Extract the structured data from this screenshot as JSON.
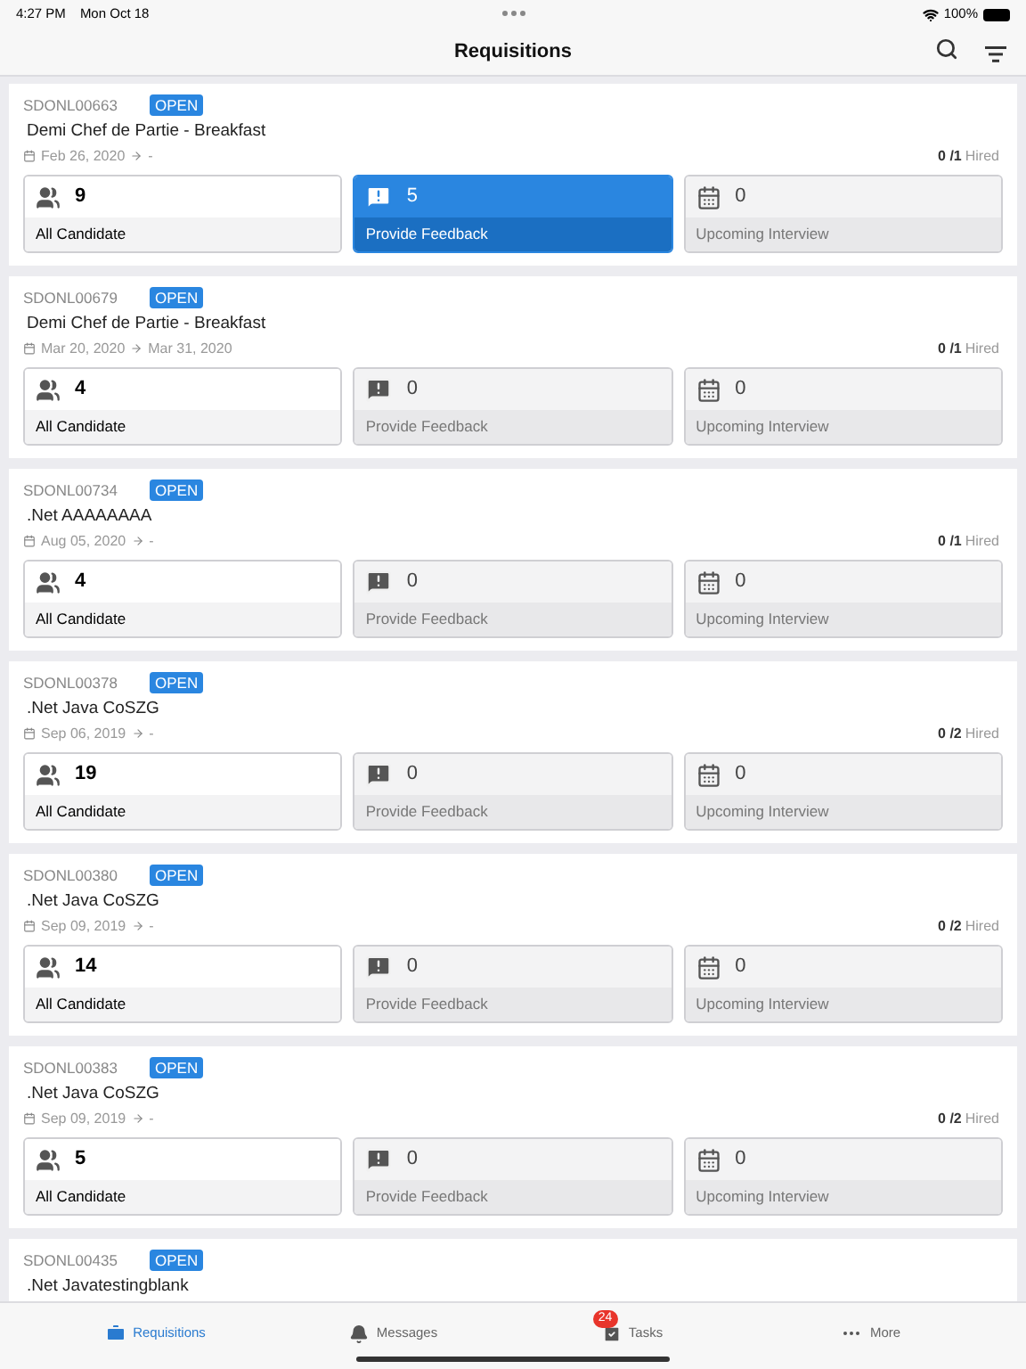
{
  "status_bar": {
    "time": "4:27 PM",
    "date": "Mon Oct 18",
    "battery": "100%"
  },
  "title": "Requisitions",
  "requisitions": [
    {
      "id": "SDONL00663",
      "status": "OPEN",
      "title": "Demi Chef de Partie - Breakfast",
      "start": "Feb 26, 2020",
      "end": "-",
      "hired": "0",
      "total": "/1",
      "hired_label": "Hired",
      "tiles": [
        {
          "kind": "candidates",
          "count": "9",
          "label": "All Candidate",
          "selected": false
        },
        {
          "kind": "feedback",
          "count": "5",
          "label": "Provide Feedback",
          "selected": true
        },
        {
          "kind": "interviews",
          "count": "0",
          "label": "Upcoming Interview",
          "selected": false
        }
      ]
    },
    {
      "id": "SDONL00679",
      "status": "OPEN",
      "title": "Demi Chef de Partie - Breakfast",
      "start": "Mar 20, 2020",
      "end": "Mar 31, 2020",
      "hired": "0",
      "total": "/1",
      "hired_label": "Hired",
      "tiles": [
        {
          "kind": "candidates",
          "count": "4",
          "label": "All Candidate",
          "selected": false
        },
        {
          "kind": "feedback",
          "count": "0",
          "label": "Provide Feedback",
          "selected": false
        },
        {
          "kind": "interviews",
          "count": "0",
          "label": "Upcoming Interview",
          "selected": false
        }
      ]
    },
    {
      "id": "SDONL00734",
      "status": "OPEN",
      "title": ".Net AAAAAAAA",
      "start": "Aug 05, 2020",
      "end": "-",
      "hired": "0",
      "total": "/1",
      "hired_label": "Hired",
      "tiles": [
        {
          "kind": "candidates",
          "count": "4",
          "label": "All Candidate",
          "selected": false
        },
        {
          "kind": "feedback",
          "count": "0",
          "label": "Provide Feedback",
          "selected": false
        },
        {
          "kind": "interviews",
          "count": "0",
          "label": "Upcoming Interview",
          "selected": false
        }
      ]
    },
    {
      "id": "SDONL00378",
      "status": "OPEN",
      "title": ".Net Java CoSZG",
      "start": "Sep 06, 2019",
      "end": "-",
      "hired": "0",
      "total": "/2",
      "hired_label": "Hired",
      "tiles": [
        {
          "kind": "candidates",
          "count": "19",
          "label": "All Candidate",
          "selected": false
        },
        {
          "kind": "feedback",
          "count": "0",
          "label": "Provide Feedback",
          "selected": false
        },
        {
          "kind": "interviews",
          "count": "0",
          "label": "Upcoming Interview",
          "selected": false
        }
      ]
    },
    {
      "id": "SDONL00380",
      "status": "OPEN",
      "title": ".Net Java CoSZG",
      "start": "Sep 09, 2019",
      "end": "-",
      "hired": "0",
      "total": "/2",
      "hired_label": "Hired",
      "tiles": [
        {
          "kind": "candidates",
          "count": "14",
          "label": "All Candidate",
          "selected": false
        },
        {
          "kind": "feedback",
          "count": "0",
          "label": "Provide Feedback",
          "selected": false
        },
        {
          "kind": "interviews",
          "count": "0",
          "label": "Upcoming Interview",
          "selected": false
        }
      ]
    },
    {
      "id": "SDONL00383",
      "status": "OPEN",
      "title": ".Net Java CoSZG",
      "start": "Sep 09, 2019",
      "end": "-",
      "hired": "0",
      "total": "/2",
      "hired_label": "Hired",
      "tiles": [
        {
          "kind": "candidates",
          "count": "5",
          "label": "All Candidate",
          "selected": false
        },
        {
          "kind": "feedback",
          "count": "0",
          "label": "Provide Feedback",
          "selected": false
        },
        {
          "kind": "interviews",
          "count": "0",
          "label": "Upcoming Interview",
          "selected": false
        }
      ]
    },
    {
      "id": "SDONL00435",
      "status": "OPEN",
      "title": ".Net Javatestingblank"
    }
  ],
  "tabs": [
    {
      "kind": "requisitions",
      "label": "Requisitions",
      "selected": true
    },
    {
      "kind": "messages",
      "label": "Messages",
      "selected": false
    },
    {
      "kind": "tasks",
      "label": "Tasks",
      "badge": "24",
      "selected": false
    },
    {
      "kind": "more",
      "label": "More",
      "selected": false
    }
  ]
}
